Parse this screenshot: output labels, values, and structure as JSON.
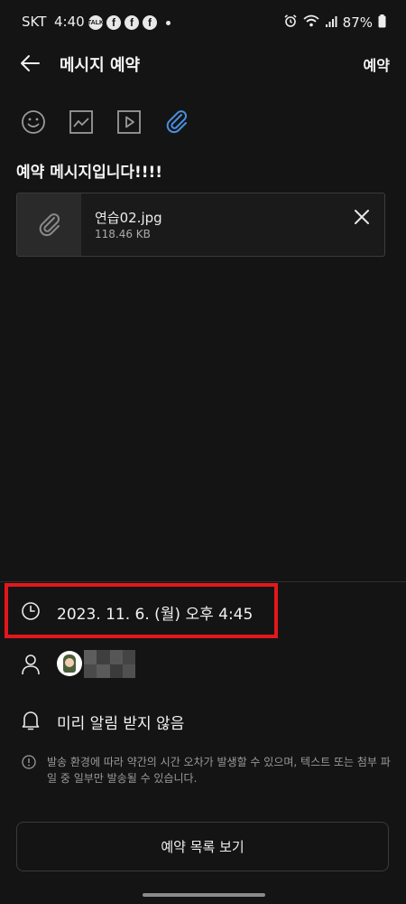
{
  "status_bar": {
    "carrier": "SKT",
    "time": "4:40",
    "battery": "87%",
    "notifications": [
      "talk-icon",
      "facebook-icon",
      "facebook-icon",
      "facebook-icon"
    ],
    "notification_talk_label": "TALK"
  },
  "header": {
    "title": "메시지 예약",
    "action_label": "예약"
  },
  "toolbar": {
    "tools": [
      "emoji-icon",
      "image-icon",
      "video-icon",
      "paperclip-icon"
    ],
    "active_color": "#4a8fe0"
  },
  "message": {
    "text": "예약 메시지입니다!!!!"
  },
  "attachment": {
    "file_name": "연습02.jpg",
    "file_size": "118.46 KB"
  },
  "schedule": {
    "datetime": "2023. 11. 6. (월) 오후 4:45"
  },
  "recipient": {
    "name_hidden": true
  },
  "reminder": {
    "label": "미리 알림 받지 않음"
  },
  "notice": {
    "text": "발송 환경에 따라 약간의 시간 오차가 발생할 수 있으며, 텍스트 또는 첨부 파일 중 일부만 발송될 수 있습니다."
  },
  "footer": {
    "list_button_label": "예약 목록 보기"
  },
  "colors": {
    "background": "#141414",
    "highlight": "#e3171b",
    "accent": "#4a8fe0"
  }
}
